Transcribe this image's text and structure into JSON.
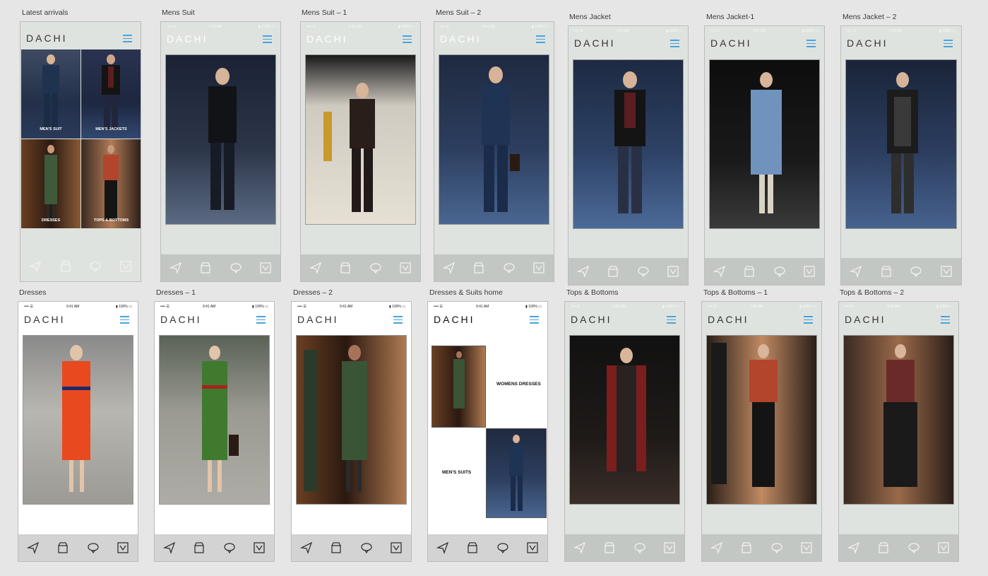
{
  "brand": "DACHI",
  "status_bar": {
    "signal": "•••• ☰",
    "time": "9:41 AM",
    "battery": "▮ 100% ▭"
  },
  "icons": {
    "send": "send-icon",
    "store": "store-icon",
    "chat": "chat-icon",
    "check": "checkbox-icon"
  },
  "artboards": [
    "Latest arrivals",
    "Mens Suit",
    "Mens Suit – 1",
    "Mens Suit – 2",
    "Mens Jacket",
    "Mens Jacket-1",
    "Mens Jacket – 2",
    "Dresses",
    "Dresses – 1",
    "Dresses – 2",
    "Dresses & Suits home",
    "Tops & Bottoms",
    "Tops & Bottoms – 1",
    "Tops & Bottoms – 2"
  ],
  "latest_arrivals": {
    "tiles": [
      "MEN'S SUIT",
      "MEN'S JACKETS",
      "DRESSES",
      "TOPS & BOTTOMS"
    ]
  },
  "home": {
    "womens": "WOMENS DRESSES",
    "mens": "MEN'S SUITS"
  }
}
